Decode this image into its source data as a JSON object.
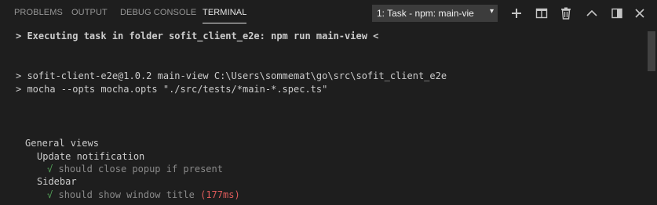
{
  "panel": {
    "tabs": [
      {
        "label": "PROBLEMS"
      },
      {
        "label": "OUTPUT"
      },
      {
        "label": "DEBUG CONSOLE"
      },
      {
        "label": "TERMINAL"
      }
    ],
    "active_tab": "TERMINAL",
    "task_select": {
      "value": "1: Task - npm: main-vie",
      "caret": "▾"
    },
    "actions": [
      "add-icon",
      "split-icon",
      "trash-icon",
      "chevron-up-icon",
      "maximize-icon",
      "close-icon"
    ]
  },
  "terminal": {
    "executing": "> Executing task in folder sofit_client_e2e: npm run main-view <",
    "cmd1": "> sofit-client-e2e@1.0.2 main-view C:\\Users\\sommemat\\go\\src\\sofit_client_e2e",
    "cmd2": "> mocha --opts mocha.opts \"./src/tests/*main-*.spec.ts\"",
    "suite": "General views",
    "sub1": "Update notification",
    "test1_mark": "√",
    "test1_text": "should close popup if present",
    "sub2": "Sidebar",
    "test2_mark": "√",
    "test2_text": "should show window title",
    "test2_time": "(177ms)"
  },
  "colors": {
    "background": "#1e1e1e",
    "pass": "#55a65a",
    "slow": "#e05b5b",
    "dim": "#8a8a8a"
  }
}
